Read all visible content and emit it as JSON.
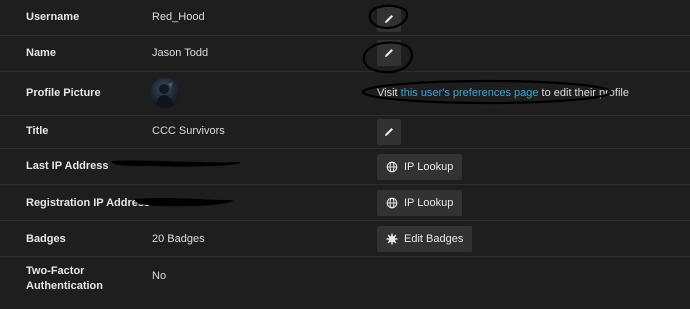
{
  "rows": [
    {
      "label": "Username",
      "value": "Red_Hood",
      "action": "edit"
    },
    {
      "label": "Name",
      "value": "Jason Todd",
      "action": "edit"
    },
    {
      "label": "Profile Picture",
      "action_text_pre": "Visit ",
      "action_link": "this user's preferences page",
      "action_text_post": " to edit their profile"
    },
    {
      "label": "Title",
      "value": "CCC Survivors",
      "action": "edit"
    },
    {
      "label": "Last IP Address",
      "button": "IP Lookup"
    },
    {
      "label": "Registration IP Address",
      "button": "IP Lookup"
    },
    {
      "label": "Badges",
      "value": "20 Badges",
      "button": "Edit Badges"
    },
    {
      "label": "Two-Factor Authentication",
      "label_line1": "Two-Factor",
      "label_line2": "Authentication",
      "value": "No"
    }
  ],
  "icons": {
    "edit": "pencil-icon",
    "ip_lookup": "globe-icon",
    "edit_badges": "badge-gear-icon"
  },
  "colors": {
    "background": "#1e1e1e",
    "button": "#323232",
    "link": "#3fa2d6"
  }
}
